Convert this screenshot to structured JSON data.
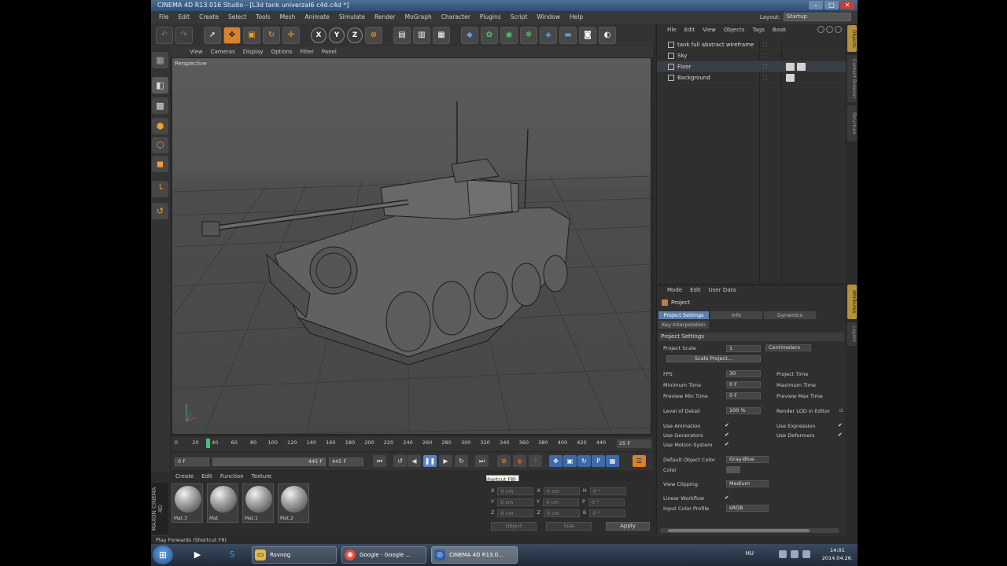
{
  "window": {
    "title": "CINEMA 4D R13.016 Studio - [L3d tank univerzal6 c4d.c4d *]"
  },
  "menubar": [
    "File",
    "Edit",
    "Create",
    "Select",
    "Tools",
    "Mesh",
    "Animate",
    "Simulate",
    "Render",
    "MoGraph",
    "Character",
    "Plugins",
    "Script",
    "Window",
    "Help"
  ],
  "layout": {
    "label": "Layout:",
    "value": "Startup"
  },
  "viewport": {
    "menu": [
      "View",
      "Cameras",
      "Display",
      "Options",
      "Filter",
      "Panel"
    ],
    "label": "Perspective"
  },
  "timeline": {
    "ticks": [
      "0",
      "20",
      "40",
      "60",
      "80",
      "100",
      "120",
      "140",
      "160",
      "180",
      "200",
      "220",
      "240",
      "260",
      "280",
      "300",
      "320",
      "340",
      "360",
      "380",
      "400",
      "420",
      "440"
    ],
    "current_frame": "25 F",
    "start_field": "0 F",
    "range_end": "445 F",
    "end_field": "445 F"
  },
  "transport": {
    "tooltip": "Play Forwards (Shortcut F8)"
  },
  "materials": {
    "menu": [
      "Create",
      "Edit",
      "Function",
      "Texture"
    ],
    "brand": "MAXON CINEMA 4D",
    "items": [
      {
        "label": "Mat.3"
      },
      {
        "label": "Mat"
      },
      {
        "label": "Mat.1"
      },
      {
        "label": "Mat.2"
      }
    ]
  },
  "coordinates": {
    "rows": [
      {
        "a": "X",
        "av": "0 cm",
        "b": "X",
        "bv": "0 cm",
        "c": "H",
        "cv": "0 °"
      },
      {
        "a": "Y",
        "av": "0 cm",
        "b": "Y",
        "bv": "0 cm",
        "c": "P",
        "cv": "0 °"
      },
      {
        "a": "Z",
        "av": "0 cm",
        "b": "Z",
        "bv": "0 cm",
        "c": "B",
        "cv": "0 °"
      }
    ],
    "mode1": "Object",
    "mode2": "Size",
    "apply": "Apply"
  },
  "statusbar": "Play Forwards (Shortcut F8)",
  "objects": {
    "menu": [
      "File",
      "Edit",
      "View",
      "Objects",
      "Tags",
      "Book"
    ],
    "items": [
      {
        "name": "tank full abstract wireframe",
        "tags": 0
      },
      {
        "name": "Sky",
        "tags": 0
      },
      {
        "name": "Floor",
        "tags": 2
      },
      {
        "name": "Background",
        "tags": 1
      }
    ]
  },
  "attributes": {
    "menu": [
      "Mode",
      "Edit",
      "User Data"
    ],
    "title": "Project",
    "tabs": [
      "Project Settings",
      "Info",
      "Dynamics",
      "Key Interpolation"
    ],
    "section": "Project Settings",
    "project_scale_label": "Project Scale",
    "project_scale_value": "1",
    "project_scale_unit": "Centimeters",
    "scale_button": "Scale Project...",
    "fps_label": "FPS",
    "fps_value": "30",
    "project_time_label": "Project Time",
    "min_time_label": "Minimum Time",
    "min_time_value": "0 F",
    "max_time_label": "Maximum Time",
    "preview_min_label": "Preview Min Time",
    "preview_min_value": "0 F",
    "preview_max_label": "Preview Max Time",
    "lod_label": "Level of Detail",
    "lod_value": "100 %",
    "render_lod_label": "Render LOD in Editor",
    "use_animation": "Use Animation",
    "use_expression": "Use Expression",
    "use_generators": "Use Generators",
    "use_deformers": "Use Deformers",
    "use_motion": "Use Motion System",
    "default_color_label": "Default Object Color",
    "default_color_value": "Gray-Blue",
    "color_label": "Color",
    "view_clipping_label": "View Clipping",
    "view_clipping_value": "Medium",
    "linear_workflow_label": "Linear Workflow",
    "input_profile_label": "Input Color Profile",
    "input_profile_value": "sRGB"
  },
  "rightstrip": [
    "Objects",
    "Content Browser",
    "Structure",
    "Attributes",
    "Layers"
  ],
  "taskbar": {
    "tasks": [
      {
        "label": "Rovnog",
        "icon": "folder-icon"
      },
      {
        "label": "Google - Google ...",
        "icon": "chrome-icon"
      },
      {
        "label": "CINEMA 4D R13.0...",
        "icon": "cinema4d-icon"
      }
    ],
    "lang": "HU",
    "time": "14:01",
    "date": "2014.04.26."
  },
  "colors": {
    "accent": "#d9822b",
    "selected_tab": "#5d7fae",
    "viewport_bg": "#505050"
  }
}
